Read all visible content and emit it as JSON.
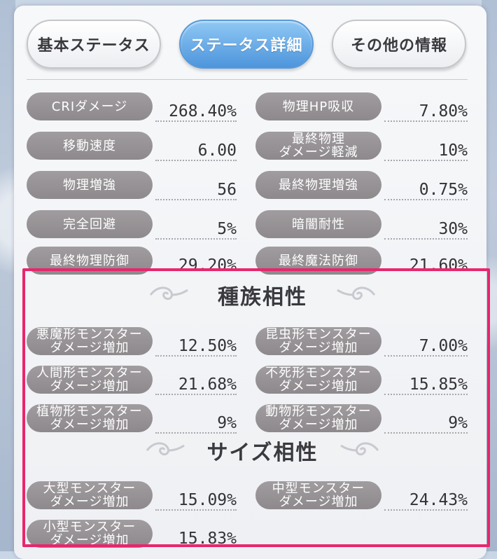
{
  "tabs": [
    {
      "label": "基本ステータス",
      "active": false
    },
    {
      "label": "ステータス詳細",
      "active": true
    },
    {
      "label": "その他の情報",
      "active": false
    }
  ],
  "stats_left": [
    {
      "label": "CRIダメージ",
      "value": "268.40%"
    },
    {
      "label": "移動速度",
      "value": "6.00"
    },
    {
      "label": "物理増強",
      "value": "56"
    },
    {
      "label": "完全回避",
      "value": "5%"
    },
    {
      "label": "最終物理防御",
      "value": "29.20%"
    }
  ],
  "stats_right": [
    {
      "label": "物理HP吸収",
      "value": "7.80%"
    },
    {
      "label": "最終物理ダメージ軽減",
      "label_line1": "最終物理",
      "label_line2": "ダメージ軽減",
      "value": "10%"
    },
    {
      "label": "最終物理増強",
      "value": "0.75%"
    },
    {
      "label": "暗闇耐性",
      "value": "30%"
    },
    {
      "label": "最終魔法防御",
      "value": "21.60%"
    }
  ],
  "race_section": {
    "title": "種族相性",
    "items": [
      {
        "line1": "悪魔形モンスター",
        "line2": "ダメージ増加",
        "value": "12.50%"
      },
      {
        "line1": "昆虫形モンスター",
        "line2": "ダメージ増加",
        "value": "7.00%"
      },
      {
        "line1": "人間形モンスター",
        "line2": "ダメージ増加",
        "value": "21.68%"
      },
      {
        "line1": "不死形モンスター",
        "line2": "ダメージ増加",
        "value": "15.85%"
      },
      {
        "line1": "植物形モンスター",
        "line2": "ダメージ増加",
        "value": "9%"
      },
      {
        "line1": "動物形モンスター",
        "line2": "ダメージ増加",
        "value": "9%"
      }
    ]
  },
  "size_section": {
    "title": "サイズ相性",
    "items": [
      {
        "line1": "大型モンスター",
        "line2": "ダメージ増加",
        "value": "15.09%"
      },
      {
        "line1": "中型モンスター",
        "line2": "ダメージ増加",
        "value": "24.43%"
      },
      {
        "line1": "小型モンスター",
        "line2": "ダメージ増加",
        "value": "15.83%"
      }
    ]
  },
  "colors": {
    "active_tab": "#4e95dc",
    "label_pill": "#8d898c",
    "highlight_border": "#e8266b"
  }
}
